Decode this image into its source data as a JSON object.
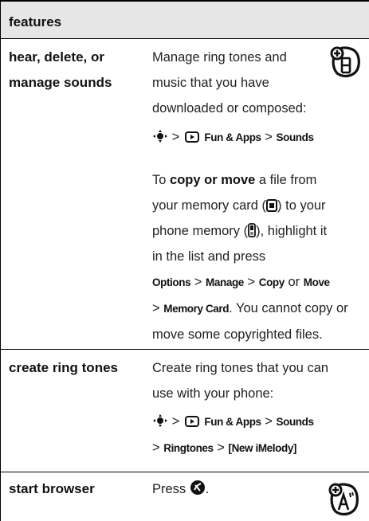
{
  "header": {
    "label": "features"
  },
  "rows": [
    {
      "feature": "hear, delete, or\nmanage sounds",
      "desc_lines": [
        "Manage ring tones and",
        "music that you have",
        "downloaded or composed:"
      ],
      "path1": {
        "sep1": ">",
        "menu": "Fun & Apps",
        "sep2": ">",
        "item": "Sounds"
      },
      "copy": {
        "line1_pre": "To ",
        "line1_bold": "copy or move",
        "line1_post": " a file from",
        "line2_pre": "your memory card (",
        "line2_post": ") to your",
        "line3_pre": "phone memory (",
        "line3_post": "), highlight it",
        "line4": "in the list and press",
        "options": "Options",
        "manage": "Manage",
        "copyk": "Copy",
        "or": "or",
        "move": "Move",
        "gt": ">",
        "memcard": "Memory Card",
        "line6_post": ". You cannot copy or",
        "line7": "move some copyrighted files."
      }
    },
    {
      "feature": "create ring tones",
      "desc_lines": [
        "Create ring tones that you can",
        "use with your phone:"
      ],
      "path": {
        "sep1": ">",
        "menu": "Fun & Apps",
        "sep2": ">",
        "item": "Sounds",
        "sep3": ">",
        "ringtones": "Ringtones",
        "sep4": ">",
        "new": "[New iMelody]"
      }
    },
    {
      "feature": "start browser",
      "desc_pre": "Press",
      "desc_post": "."
    }
  ],
  "icons": {
    "row1_side": "feature-network-icon",
    "row3_side": "browser-feature-icon",
    "nav": "nav-key-icon",
    "apps": "fun-apps-icon",
    "memory_card": "memory-card-icon",
    "phone_memory": "phone-memory-icon",
    "browser_key": "browser-key-icon"
  },
  "colors": {
    "header_bg": "#e6e6e6",
    "text": "#222222",
    "rule": "#000000"
  }
}
